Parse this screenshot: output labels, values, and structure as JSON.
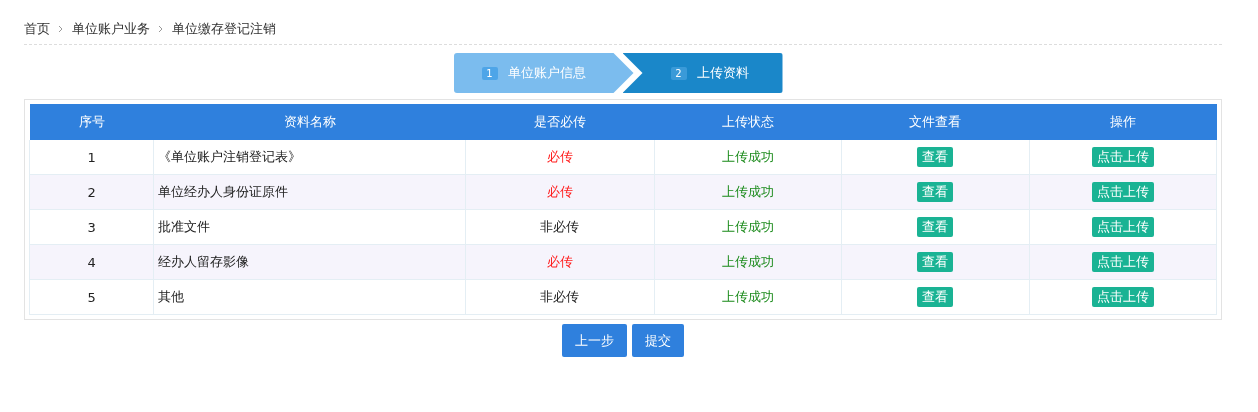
{
  "breadcrumb": [
    "首页",
    "单位账户业务",
    "单位缴存登记注销"
  ],
  "steps": [
    {
      "number": "1",
      "label": "单位账户信息",
      "selected": false
    },
    {
      "number": "2",
      "label": "上传资料",
      "selected": true
    }
  ],
  "table": {
    "columns": [
      "序号",
      "资料名称",
      "是否必传",
      "上传状态",
      "文件查看",
      "操作"
    ],
    "rows": [
      {
        "index": "1",
        "name": "《单位账户注销登记表》",
        "required_text": "必传",
        "required": true,
        "status": "上传成功",
        "view": "查看",
        "action": "点击上传"
      },
      {
        "index": "2",
        "name": "单位经办人身份证原件",
        "required_text": "必传",
        "required": true,
        "status": "上传成功",
        "view": "查看",
        "action": "点击上传"
      },
      {
        "index": "3",
        "name": "批准文件",
        "required_text": "非必传",
        "required": false,
        "status": "上传成功",
        "view": "查看",
        "action": "点击上传"
      },
      {
        "index": "4",
        "name": "经办人留存影像",
        "required_text": "必传",
        "required": true,
        "status": "上传成功",
        "view": "查看",
        "action": "点击上传"
      },
      {
        "index": "5",
        "name": "其他",
        "required_text": "非必传",
        "required": false,
        "status": "上传成功",
        "view": "查看",
        "action": "点击上传"
      }
    ]
  },
  "buttons": [
    "上一步",
    "提交"
  ]
}
